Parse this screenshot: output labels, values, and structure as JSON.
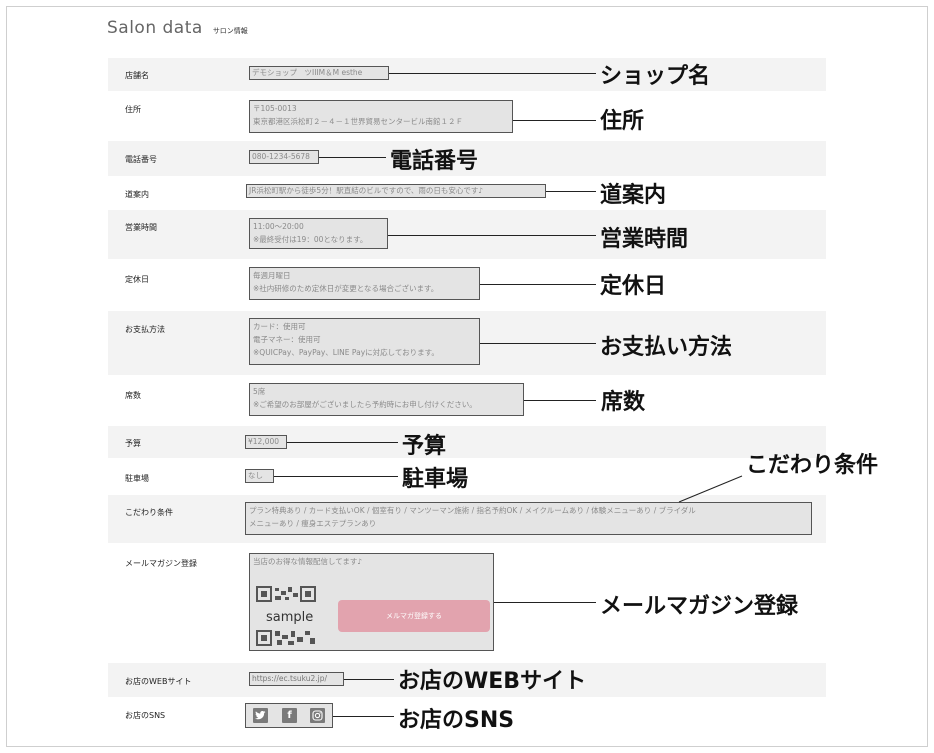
{
  "header": {
    "title": "Salon data",
    "subtitle": "サロン情報"
  },
  "rows": {
    "shop_name": {
      "label": "店舗名",
      "value": "デモショップ　ツIIIM＆M esthe",
      "annotation": "ショップ名"
    },
    "address": {
      "label": "住所",
      "line1": "〒105-0013",
      "line2": "東京都港区浜松町２－４－１世界貿易センタービル南館１２Ｆ",
      "annotation": "住所"
    },
    "phone": {
      "label": "電話番号",
      "value": "080-1234-5678",
      "annotation": "電話番号"
    },
    "directions": {
      "label": "道案内",
      "value": "JR浜松町駅から徒歩5分！駅直結のビルですので、雨の日も安心です♪",
      "annotation": "道案内"
    },
    "hours": {
      "label": "営業時間",
      "line1": "11:00〜20:00",
      "line2": "※最終受付は19：00となります。",
      "annotation": "営業時間"
    },
    "closed": {
      "label": "定休日",
      "line1": "毎週月曜日",
      "line2": "※社内研修のため定休日が変更となる場合ございます。",
      "annotation": "定休日"
    },
    "payment": {
      "label": "お支払方法",
      "line1": "カード：使用可",
      "line2": "電子マネー：使用可",
      "line3": "※QUICPay、PayPay、LINE Payに対応しております。",
      "annotation": "お支払い方法"
    },
    "seats": {
      "label": "席数",
      "line1": "5席",
      "line2": "※ご希望のお部屋がございましたら予約時にお申し付けください。",
      "annotation": "席数"
    },
    "budget": {
      "label": "予算",
      "value": "¥12,000",
      "annotation": "予算"
    },
    "parking": {
      "label": "駐車場",
      "value": "なし",
      "annotation": "駐車場"
    },
    "features": {
      "label": "こだわり条件",
      "line1": "プラン特典あり / カード支払いOK / 個室有り / マンツーマン施術 / 指名予約OK / メイクルームあり / 体験メニューあり / ブライダル",
      "line2": "メニューあり / 痩身エステプランあり",
      "annotation": "こだわり条件"
    },
    "mail": {
      "label": "メールマガジン登録",
      "intro": "当店のお得な情報配信してます♪",
      "qr_text": "sample",
      "button": "メルマガ登録する",
      "annotation": "メールマガジン登録"
    },
    "web": {
      "label": "お店のWEBサイト",
      "value": "https://ec.tsuku2.jp/",
      "annotation": "お店のWEBサイト"
    },
    "sns": {
      "label": "お店のSNS",
      "icons": [
        "twitter-icon",
        "facebook-icon",
        "instagram-icon"
      ],
      "annotation": "お店のSNS"
    }
  }
}
